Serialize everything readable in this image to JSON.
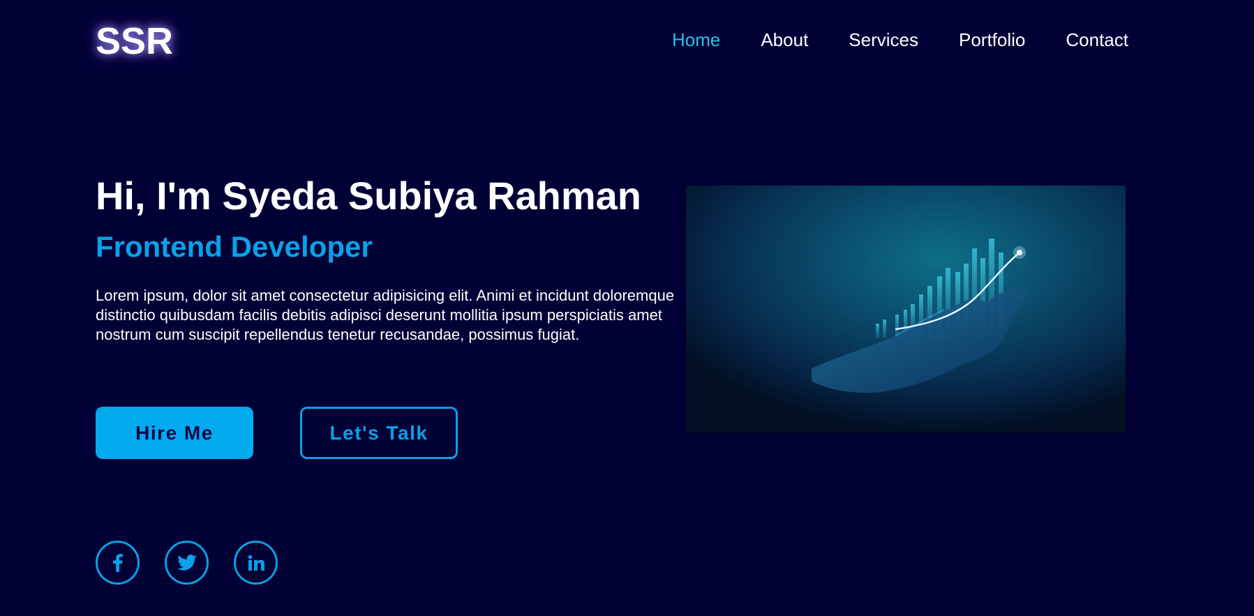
{
  "header": {
    "logo": "SSR",
    "nav": [
      {
        "label": "Home",
        "active": true
      },
      {
        "label": "About",
        "active": false
      },
      {
        "label": "Services",
        "active": false
      },
      {
        "label": "Portfolio",
        "active": false
      },
      {
        "label": "Contact",
        "active": false
      }
    ]
  },
  "hero": {
    "title": "Hi, I'm Syeda Subiya Rahman",
    "role": "Frontend Developer",
    "description": "Lorem ipsum, dolor sit amet consectetur adipisicing elit. Animi et incidunt doloremque distinctio quibusdam facilis debitis adipisci deserunt mollitia ipsum perspiciatis amet nostrum cum suscipit repellendus tenetur recusandae, possimus fugiat.",
    "buttons": {
      "hire_label": "Hire Me",
      "talk_label": "Let's Talk"
    },
    "image": {
      "icon": "growth-chart-hand-image"
    }
  },
  "social": [
    {
      "icon": "facebook-icon"
    },
    {
      "icon": "twitter-icon"
    },
    {
      "icon": "linkedin-icon"
    }
  ],
  "colors": {
    "background": "#020136",
    "accent": "#0aa1e8",
    "nav_active": "#27c3e6",
    "text": "#ffffff"
  }
}
